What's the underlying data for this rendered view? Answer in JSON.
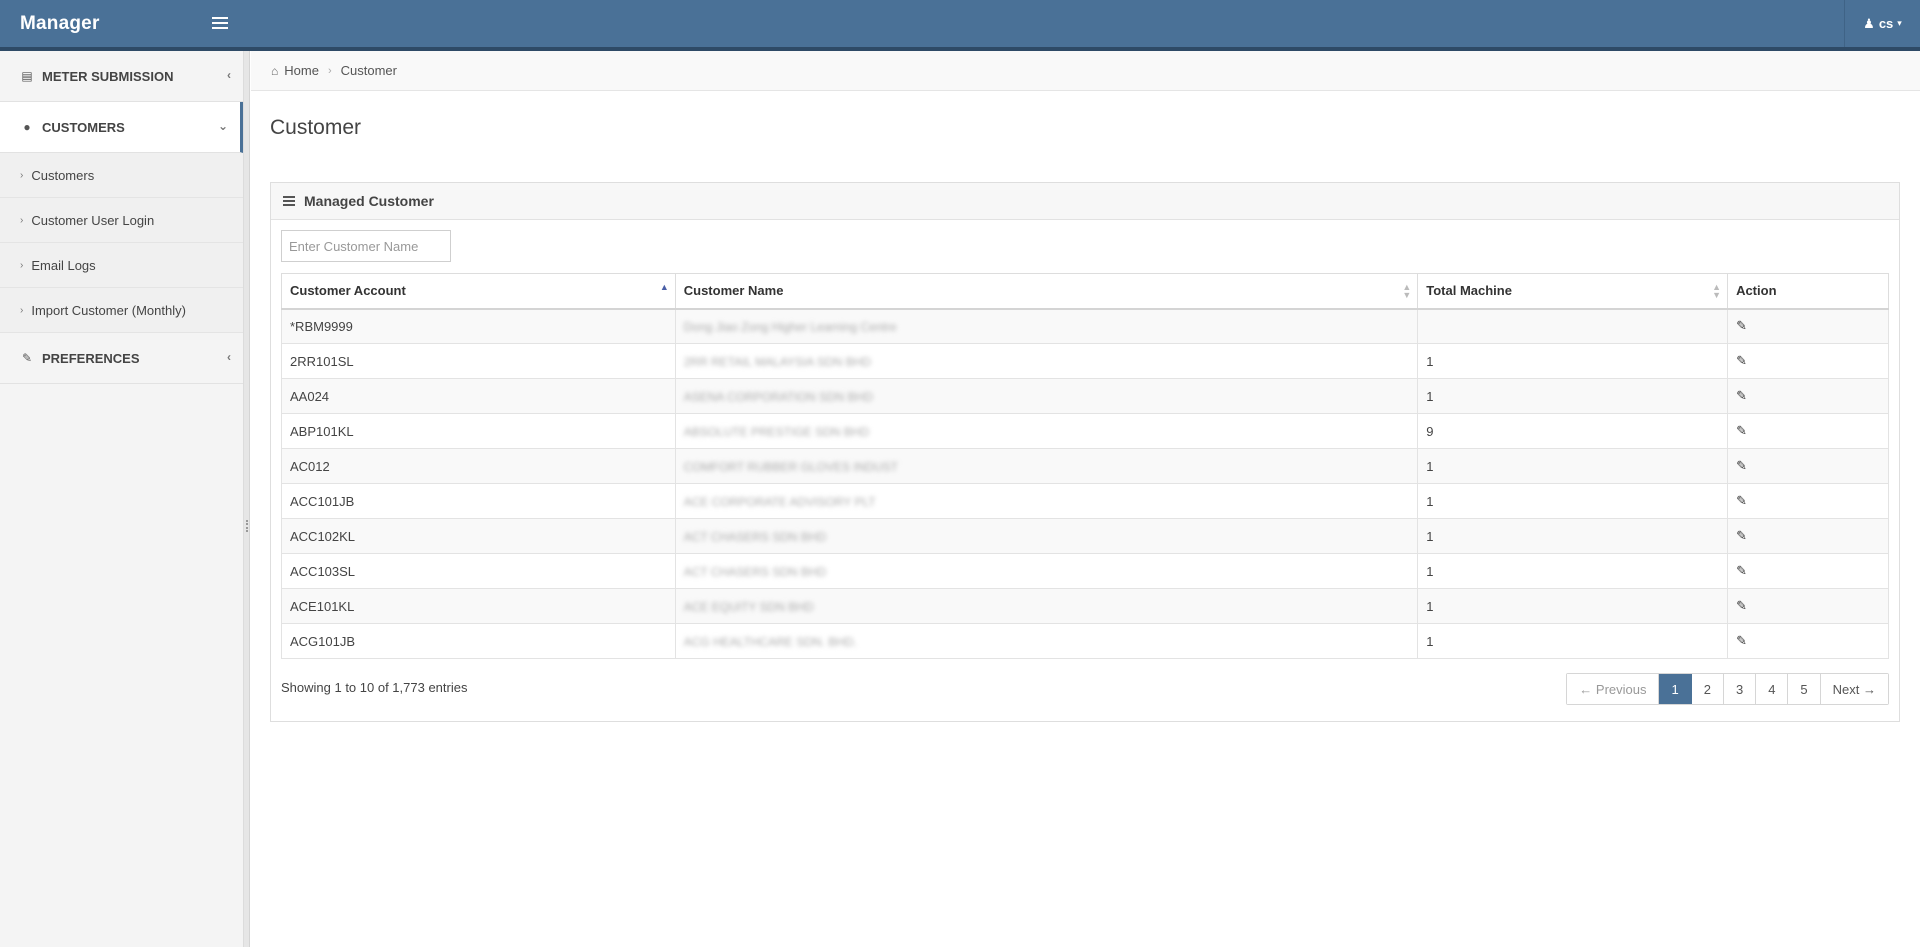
{
  "app": {
    "brand": "Manager",
    "user": "cs"
  },
  "sidebar": {
    "sections": [
      {
        "label": "METER SUBMISSION",
        "icon": "file-icon"
      },
      {
        "label": "CUSTOMERS",
        "icon": "user-icon"
      },
      {
        "label": "PREFERENCES",
        "icon": "edit-icon"
      }
    ],
    "sub_items": [
      {
        "label": "Customers"
      },
      {
        "label": "Customer User Login"
      },
      {
        "label": "Email Logs"
      },
      {
        "label": "Import Customer (Monthly)"
      }
    ]
  },
  "breadcrumb": {
    "home": "Home",
    "current": "Customer"
  },
  "page": {
    "title": "Customer"
  },
  "panel": {
    "title": "Managed Customer",
    "search_placeholder": "Enter Customer Name"
  },
  "table": {
    "headers": [
      "Customer Account",
      "Customer Name",
      "Total Machine",
      "Action"
    ],
    "rows": [
      {
        "account": "*RBM9999",
        "name": "Dong Jiao Zong Higher Learning Centre",
        "total": ""
      },
      {
        "account": "2RR101SL",
        "name": "2RR RETAIL MALAYSIA SDN BHD",
        "total": "1"
      },
      {
        "account": "AA024",
        "name": "ASENA CORPORATION SDN BHD",
        "total": "1"
      },
      {
        "account": "ABP101KL",
        "name": "ABSOLUTE PRESTIGE SDN BHD",
        "total": "9"
      },
      {
        "account": "AC012",
        "name": "COMFORT RUBBER GLOVES INDUST",
        "total": "1"
      },
      {
        "account": "ACC101JB",
        "name": "ACE CORPORATE ADVISORY PLT",
        "total": "1"
      },
      {
        "account": "ACC102KL",
        "name": "ACT CHASERS SDN BHD",
        "total": "1"
      },
      {
        "account": "ACC103SL",
        "name": "ACT CHASERS SDN BHD",
        "total": "1"
      },
      {
        "account": "ACE101KL",
        "name": "ACE EQUITY SDN BHD",
        "total": "1"
      },
      {
        "account": "ACG101JB",
        "name": "ACG HEALTHCARE SDN. BHD.",
        "total": "1"
      }
    ]
  },
  "footer": {
    "info": "Showing 1 to 10 of 1,773 entries",
    "pagination": [
      "← Previous",
      "1",
      "2",
      "3",
      "4",
      "5",
      "Next →"
    ]
  }
}
